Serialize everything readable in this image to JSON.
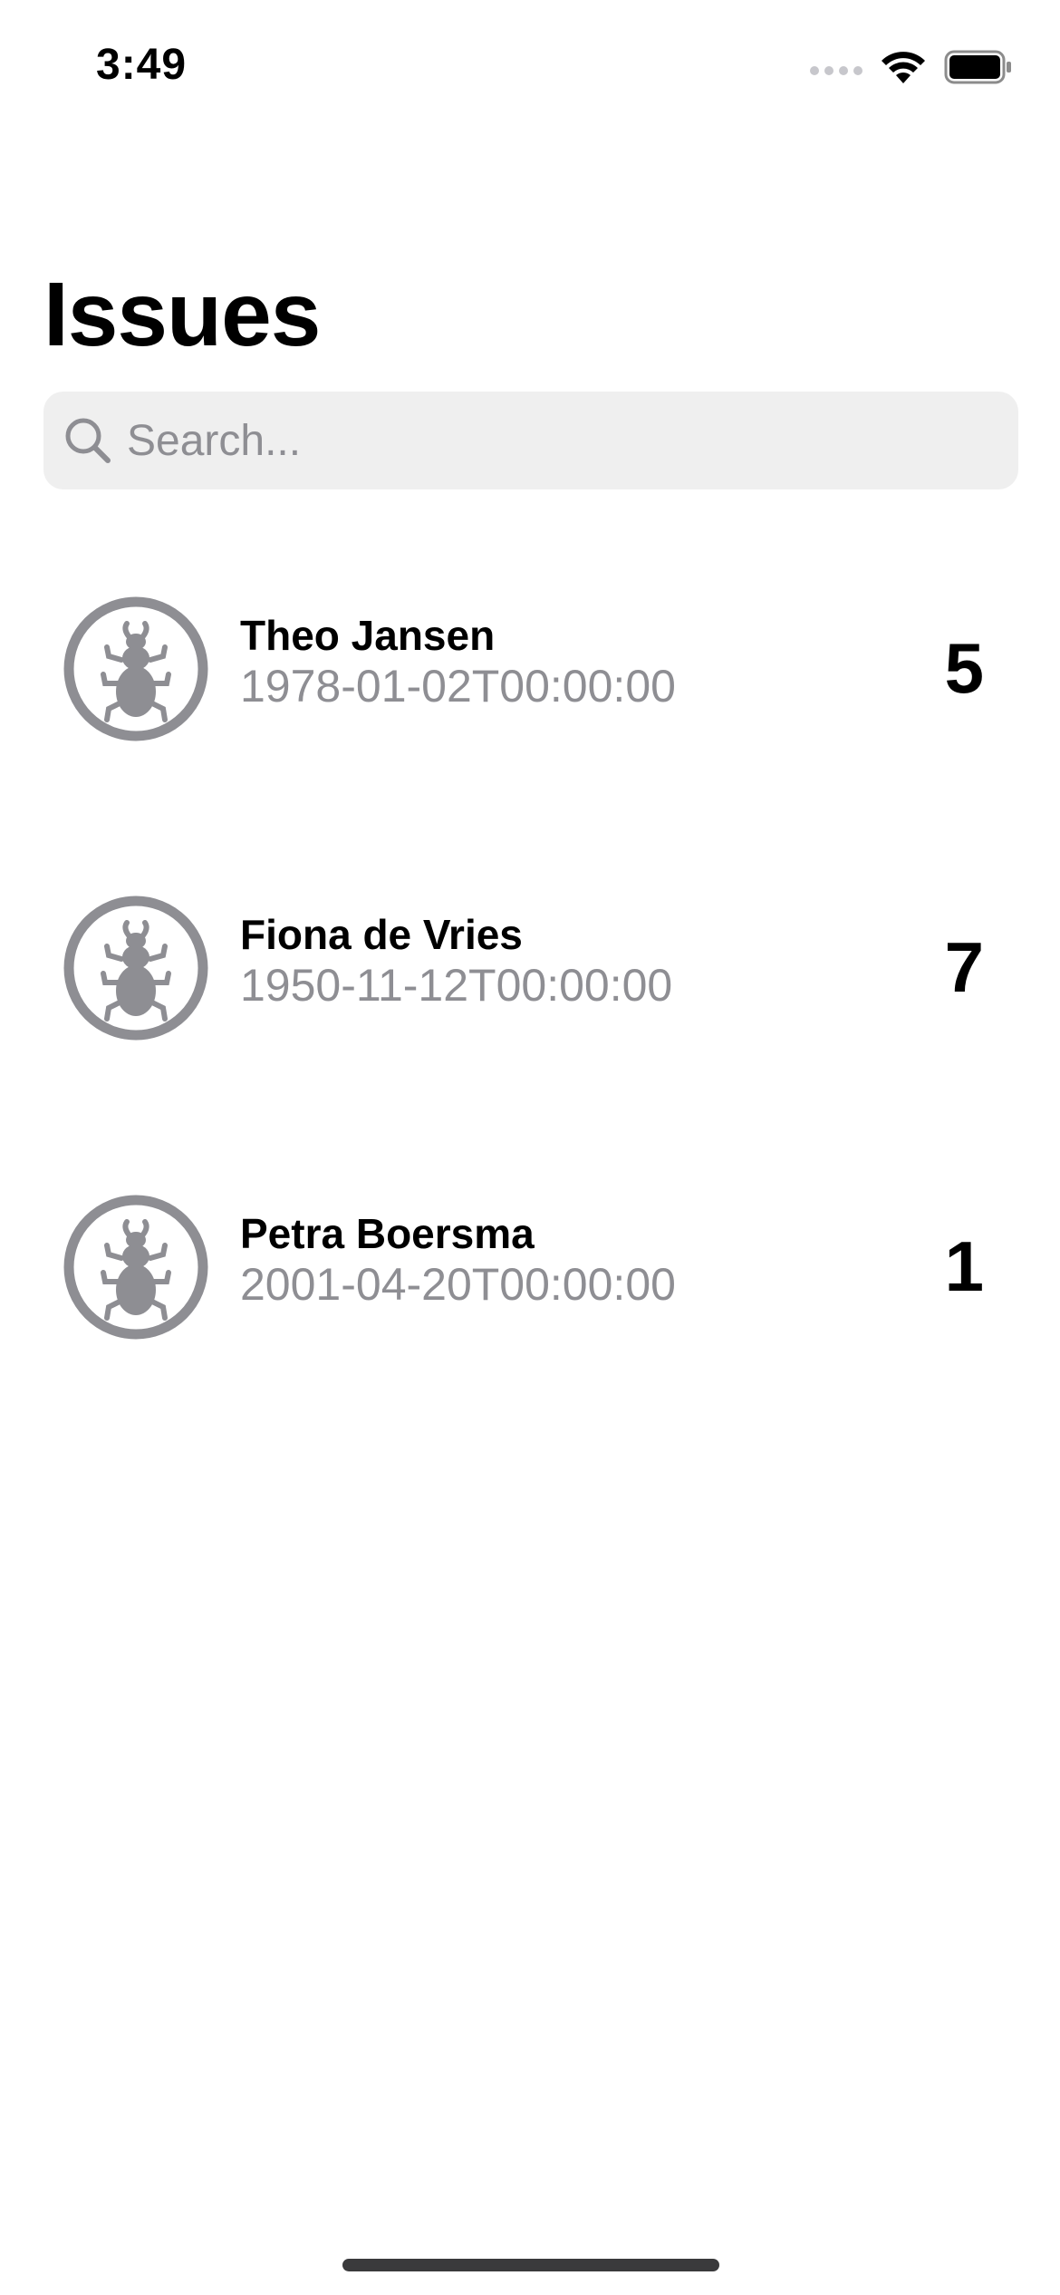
{
  "status_bar": {
    "time": "3:49"
  },
  "header": {
    "title": "Issues"
  },
  "search": {
    "placeholder": "Search...",
    "value": ""
  },
  "issues": [
    {
      "name": "Theo Jansen",
      "date": "1978-01-02T00:00:00",
      "count": "5",
      "icon": "bug-icon"
    },
    {
      "name": "Fiona de Vries",
      "date": "1950-11-12T00:00:00",
      "count": "7",
      "icon": "bug-icon"
    },
    {
      "name": "Petra Boersma",
      "date": "2001-04-20T00:00:00",
      "count": "1",
      "icon": "bug-icon"
    }
  ],
  "colors": {
    "secondary_text": "#8e8e93",
    "icon_gray": "#8e8e93",
    "search_bg": "#efefef"
  }
}
